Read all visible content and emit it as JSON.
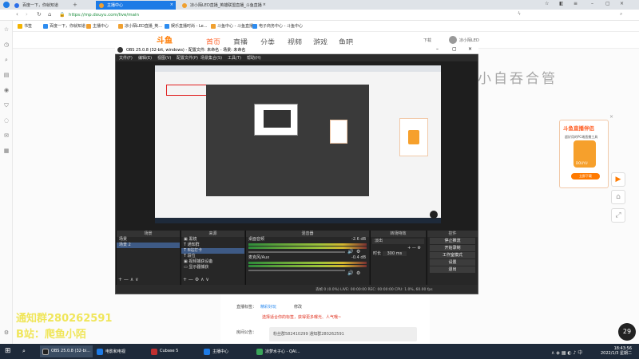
{
  "browser": {
    "tabs": [
      {
        "label": "百度一下，你就知道",
        "active": false
      },
      {
        "label": "主播中心",
        "active": true
      },
      {
        "label": "凉小陌LED直播_英雄联盟直播_斗鱼直播",
        "active": false
      }
    ],
    "url": "https://mp.douyu.com/live/main",
    "bookmarks": [
      "书签",
      "百度一下，你就知道",
      "主播中心",
      "凉小陌LED直播_英...",
      "娱乐直播时尚 - Le...",
      "斗鱼中心 - 斗鱼直播",
      "电子商务中心 - 斗鱼中心"
    ]
  },
  "douyu": {
    "logo": "斗鱼",
    "nav": [
      "首页",
      "直播",
      "分类",
      "视频",
      "游戏",
      "鱼吧"
    ],
    "download": "下载",
    "user": "凉小陌LED",
    "promo": {
      "title": "斗鱼直播伴侣",
      "subtitle": "超好用的PC端直播工具",
      "icon_text": "DOUYU",
      "button": "立即下载"
    },
    "form": {
      "tag_label": "直播标签：",
      "tag_value": "精彩好玩",
      "edit": "修改",
      "tag_hint": "选择适合你的标签，获得更多曝光、人气哦~",
      "notice_label": "房间公告：",
      "notice_value": "粉丝群582410299 通知群280262591"
    },
    "avatar_text": "29"
  },
  "watermark": "打半小自吞合管",
  "overlay": {
    "line1": "通知群280262591",
    "line2": "B站：爬鱼小陌"
  },
  "obs": {
    "title": "OBS 25.0.8 (32-bit, windows) - 配置文件: 未命名 - 场景: 未命名",
    "menu": [
      "文件(F)",
      "编辑(E)",
      "视图(V)",
      "配置文件(P)",
      "场景集合(S)",
      "工具(T)",
      "帮助(H)"
    ],
    "scenes_header": "场景",
    "scenes": [
      "场景",
      "场景 2"
    ],
    "sources_header": "来源",
    "sources": [
      "黑镜",
      "通知群",
      "B站打卡",
      "段位",
      "视频捕获设备",
      "显示器捕获"
    ],
    "mixer_header": "混音器",
    "mixer": [
      {
        "name": "桌面音频",
        "db": "-2.6 dB"
      },
      {
        "name": "麦克风/Aux",
        "db": "-0.4 dB"
      }
    ],
    "transition_header": "转场特效",
    "transition": {
      "type": "淡出",
      "duration_label": "时长",
      "duration": "300 ms"
    },
    "controls_header": "控件",
    "controls": [
      "停止推流",
      "开始录制",
      "工作室模式",
      "设置",
      "退出"
    ],
    "status": "丢帧 0 (0.0%)   LIVE: 00:00:00   REC: 00:00:00   CPU: 1.0%, 60.00 fps"
  },
  "taskbar": {
    "items": [
      "OBS 25.0.8 (32-bi...",
      "电影和电视",
      "Cubase 5",
      "主播中心",
      "凉梦水子心 - QAI..."
    ],
    "time": "18:43:56",
    "date": "2022/1/3 星期二"
  }
}
